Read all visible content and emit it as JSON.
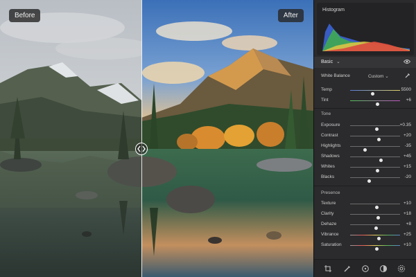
{
  "compare": {
    "before_label": "Before",
    "after_label": "After",
    "divider_position": 0.45
  },
  "histogram": {
    "title": "Histogram",
    "channels": [
      "blue",
      "green",
      "yellow",
      "red"
    ]
  },
  "basic": {
    "title": "Basic",
    "white_balance_label": "White Balance",
    "white_balance_value": "Custom",
    "temp": {
      "label": "Temp",
      "value": "5500",
      "position": 0.45
    },
    "tint": {
      "label": "Tint",
      "value": "+6",
      "position": 0.55
    }
  },
  "tone": {
    "title": "Tone",
    "sliders": [
      {
        "label": "Exposure",
        "value": "+0.35",
        "position": 0.53
      },
      {
        "label": "Contrast",
        "value": "+20",
        "position": 0.58
      },
      {
        "label": "Highlights",
        "value": "-35",
        "position": 0.3
      },
      {
        "label": "Shadows",
        "value": "+45",
        "position": 0.62
      },
      {
        "label": "Whites",
        "value": "+15",
        "position": 0.55
      },
      {
        "label": "Blacks",
        "value": "-20",
        "position": 0.38
      }
    ]
  },
  "presence": {
    "title": "Presence",
    "sliders": [
      {
        "label": "Texture",
        "value": "+10",
        "position": 0.53
      },
      {
        "label": "Clarity",
        "value": "+18",
        "position": 0.56
      },
      {
        "label": "Dehaze",
        "value": "+8",
        "position": 0.52
      },
      {
        "label": "Vibrance",
        "value": "+25",
        "position": 0.58
      },
      {
        "label": "Saturation",
        "value": "+10",
        "position": 0.53
      }
    ]
  },
  "toolbar": {
    "icons": [
      "crop-icon",
      "brush-icon",
      "filter-icon",
      "color-icon",
      "settings-icon"
    ]
  },
  "colors": {
    "panel_bg": "#2b2b2d",
    "slider_thumb": "#e7e7e7"
  }
}
